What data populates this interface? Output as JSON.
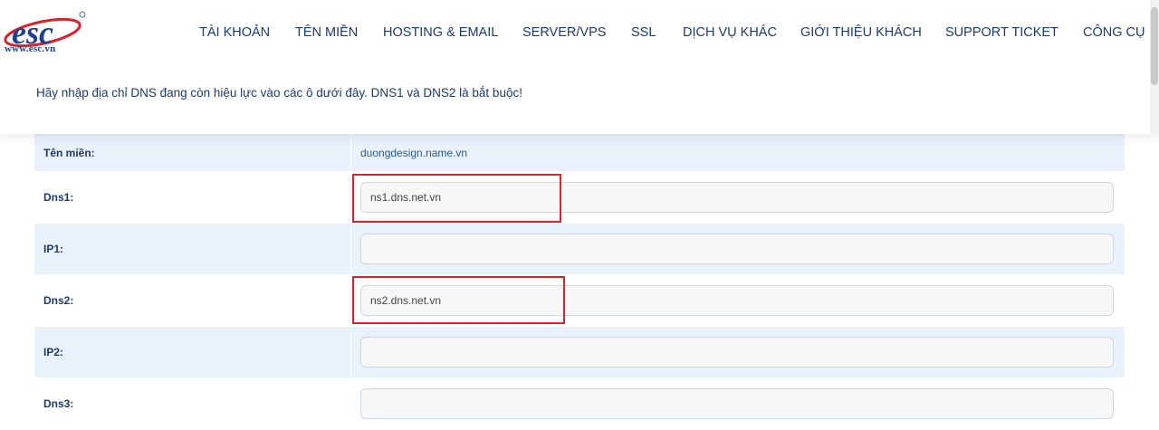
{
  "logo": {
    "text": "esc",
    "url": "www.esc.vn"
  },
  "nav": {
    "items": [
      {
        "label": "TÀI KHOẢN"
      },
      {
        "label": "TÊN MIỀN"
      },
      {
        "label": "HOSTING & EMAIL"
      },
      {
        "label": "SERVER/VPS"
      },
      {
        "label": "SSL"
      },
      {
        "label": "DỊCH VỤ KHÁC"
      },
      {
        "label": "GIỚI THIỆU KHÁCH"
      },
      {
        "label": "SUPPORT TICKET"
      },
      {
        "label": "CÔNG CỤ"
      }
    ]
  },
  "instruction": "Hãy nhập địa chỉ DNS đang còn hiệu lực vào các ô dưới đây. DNS1 và DNS2 là bắt buộc!",
  "form": {
    "domain": {
      "label": "Tên miền:",
      "value": "duongdesign.name.vn"
    },
    "dns1": {
      "label": "Dns1:",
      "value": "ns1.dns.net.vn"
    },
    "ip1": {
      "label": "IP1:",
      "value": ""
    },
    "dns2": {
      "label": "Dns2:",
      "value": "ns2.dns.net.vn"
    },
    "ip2": {
      "label": "IP2:",
      "value": ""
    },
    "dns3": {
      "label": "Dns3:",
      "value": ""
    }
  },
  "colors": {
    "accent_text": "#1d3a6a",
    "row_shade": "#e9f1fa",
    "highlight": "#d9232d"
  }
}
